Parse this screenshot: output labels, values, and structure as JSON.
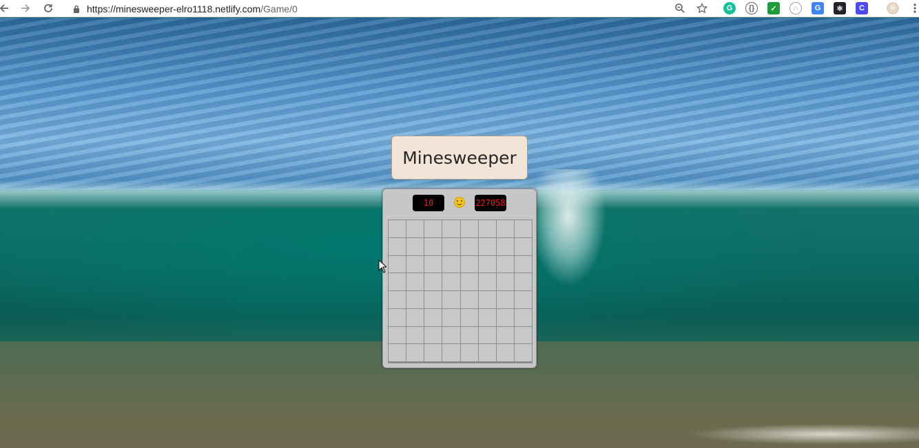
{
  "browser": {
    "url_host": "https://minesweeper-elro1118.netlify.com",
    "url_path": "/Game/0",
    "extensions": [
      {
        "name": "grammarly-icon",
        "glyph": "G",
        "color": "#15c39a"
      },
      {
        "name": "json-viewer-icon",
        "glyph": "{}",
        "color": "#5f6368"
      },
      {
        "name": "checkmark-extension-icon",
        "glyph": "✓",
        "color": "#1e9b3a"
      },
      {
        "name": "headphones-extension-icon",
        "glyph": "∩",
        "color": "#9aa0a6"
      },
      {
        "name": "google-translate-icon",
        "glyph": "G",
        "color": "#4285f4"
      },
      {
        "name": "react-devtools-icon",
        "glyph": "⚛",
        "color": "#20232a"
      },
      {
        "name": "c-extension-icon",
        "glyph": "C",
        "color": "#4a4af0"
      }
    ]
  },
  "game": {
    "title": "Minesweeper",
    "mine_counter": "10",
    "timer": "227058",
    "rows": 8,
    "cols": 8
  }
}
